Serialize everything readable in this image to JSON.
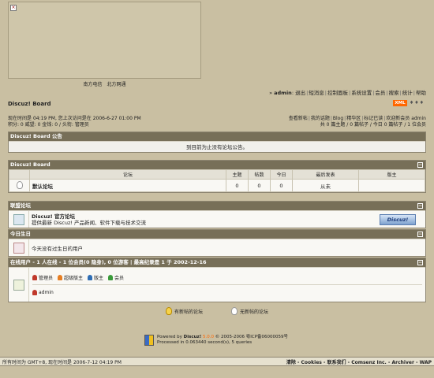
{
  "banner": {
    "caption": "南方电信　北方网通"
  },
  "topnav": {
    "user_prefix": "»",
    "user": "admin",
    "items": [
      "退出",
      "短消息",
      "控制面板",
      "系统设置",
      "会员",
      "搜索",
      "统计",
      "帮助"
    ]
  },
  "site": {
    "title": "Discuz! Board",
    "xml_badge": "XML",
    "dots": "♦♦♦"
  },
  "info": {
    "now_label": "现在时间是",
    "now_time": "04:19 PM",
    "last_visit_label": ", 您上次访问是在",
    "last_visit_time": "2006-6-27 01:00 PM",
    "stats_line": "积分: 0  威望: 0  金钱: 0  / 头衔: 管理员",
    "links": [
      "查看新帖",
      "我的话题",
      "Blog",
      "精华区",
      "标记已读",
      "欢迎新会员 admin"
    ],
    "totals": "共 0 篇主题 / 0 篇帖子 / 今日 0 篇帖子 / 1 位会员"
  },
  "announce": {
    "header": "Discuz! Board 公告",
    "text": "到目前为止没有论坛公告。"
  },
  "forum": {
    "header": "Discuz! Board",
    "columns": [
      "论坛",
      "主题",
      "帖数",
      "今日",
      "最后发表",
      "版主"
    ],
    "rows": [
      {
        "name": "默认论坛",
        "topics": "0",
        "posts": "0",
        "today": "0",
        "last_post": "从未",
        "moderator": ""
      }
    ]
  },
  "links_box": {
    "header": "联盟论坛",
    "title": "Discuz! 官方论坛",
    "desc": "提供最新 Discuz! 产品新闻、软件下载与技术交流",
    "logo_text": "Discuz!"
  },
  "birthday": {
    "header": "今日生日",
    "text": "今天没有过生日的用户"
  },
  "online": {
    "header_label": "在线用户",
    "header_detail": "- 1 人在线 - 1 位会员(0 隐身), 0 位游客 | 最高纪录是 1 于 2002-12-16",
    "legend": [
      {
        "label": "管理员",
        "color": "#c0392b"
      },
      {
        "label": "超级版主",
        "color": "#e67e22"
      },
      {
        "label": "版主",
        "color": "#2e6db4"
      },
      {
        "label": "会员",
        "color": "#3a9a3a"
      }
    ],
    "users": [
      "admin"
    ]
  },
  "bottom_legend": {
    "new": "有新帖的论坛",
    "no_new": "无新帖的论坛"
  },
  "powered": {
    "line1_prefix": "Powered by",
    "brand": "Discuz!",
    "version": "5.0.0",
    "line1_suffix": "© 2005-2006 粤ICP备06000059号",
    "line2": "Processed in 0.063440 second(s), 5 queries"
  },
  "footer": {
    "left": "所有时间为  GMT+8, 现在时间是  2006-7-12 04:19 PM",
    "right": [
      "清除",
      "Cookies",
      "联系我们",
      "Comsenz Inc.",
      "Archiver",
      "WAP"
    ]
  },
  "colors": {
    "header_bg": "#776f58",
    "page_bg": "#c9bfa2",
    "accent_orange": "#ff6600"
  }
}
